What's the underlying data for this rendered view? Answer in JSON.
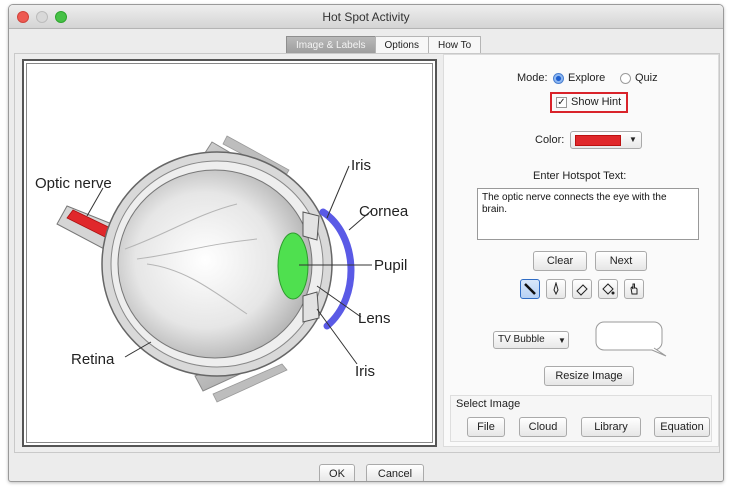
{
  "window": {
    "title": "Hot Spot Activity"
  },
  "tabs": [
    {
      "label": "Image & Labels",
      "active": true
    },
    {
      "label": "Options",
      "active": false
    },
    {
      "label": "How To",
      "active": false
    }
  ],
  "diagram": {
    "labels": {
      "optic_nerve": "Optic nerve",
      "iris_top": "Iris",
      "cornea": "Cornea",
      "pupil": "Pupil",
      "lens": "Lens",
      "iris_bottom": "Iris",
      "retina": "Retina"
    },
    "highlight_colors": {
      "optic_nerve": "#e0282b",
      "lens": "#4fe04f",
      "cornea": "#5a5ae6"
    }
  },
  "settings": {
    "mode_label": "Mode:",
    "mode_options": [
      "Explore",
      "Quiz"
    ],
    "mode_selected": "Explore",
    "show_hint_label": "Show Hint",
    "show_hint_checked": true,
    "color_label": "Color:",
    "color_value": "#e0282b",
    "hotspot_text_label": "Enter Hotspot Text:",
    "hotspot_text": "The optic nerve connects the eye with the brain.",
    "clear_label": "Clear",
    "next_label": "Next",
    "tools": [
      "line-tool-icon",
      "pen-tool-icon",
      "eraser-tool-icon",
      "fill-tool-icon",
      "hand-tool-icon"
    ],
    "bubble_style": "TV Bubble",
    "resize_label": "Resize Image",
    "select_image": {
      "legend": "Select Image",
      "buttons": [
        "File",
        "Cloud",
        "Library",
        "Equation"
      ]
    }
  },
  "footer": {
    "ok_label": "OK",
    "cancel_label": "Cancel"
  }
}
